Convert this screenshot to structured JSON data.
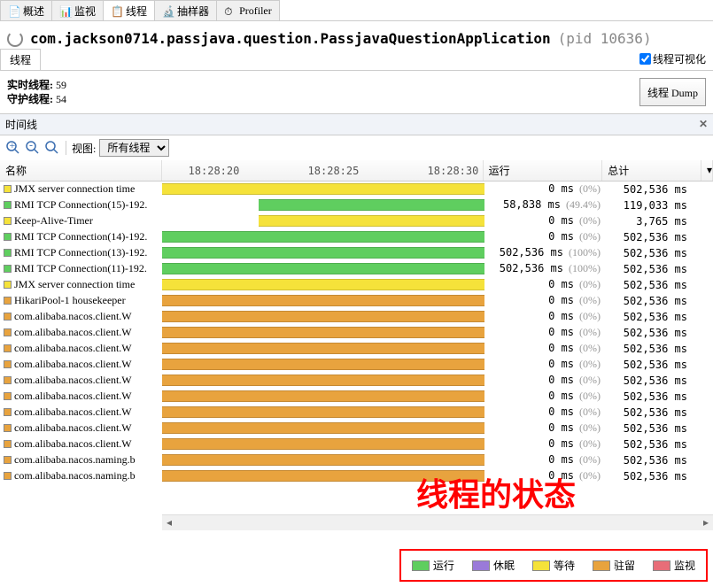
{
  "tabs": [
    "概述",
    "监视",
    "线程",
    "抽样器",
    "Profiler"
  ],
  "active_tab_index": 2,
  "app": "com.jackson0714.passjava.question.PassjavaQuestionApplication",
  "pid_label": "(pid 10636)",
  "sub_tab": "线程",
  "viz_checkbox": "线程可视化",
  "viz_checked": true,
  "stats": {
    "live_label": "实时线程:",
    "live": "59",
    "daemon_label": "守护线程:",
    "daemon": "54"
  },
  "dump_btn": "线程 Dump",
  "timeline_label": "时间线",
  "toolbar": {
    "zoom_in": "+",
    "zoom_out": "-",
    "zoom_fit": "↔",
    "view_label": "视图:",
    "view_value": "所有线程"
  },
  "cols": {
    "name": "名称",
    "run": "运行",
    "total": "总计"
  },
  "ticks": [
    "18:28:20",
    "18:28:25",
    "18:28:30"
  ],
  "colors": {
    "run": "#5fce5f",
    "sleep": "#9a7ad9",
    "wait": "#f5e23a",
    "park": "#e8a33e",
    "monitor": "#e86d78"
  },
  "rows": [
    {
      "name": "JMX server connection time",
      "state": "wait",
      "run": "0 ms",
      "pct": "(0%)",
      "tot": "502,536 ms"
    },
    {
      "name": "RMI TCP Connection(15)-192.",
      "state": "run",
      "run": "58,838 ms",
      "pct": "(49.4%)",
      "tot": "119,033 ms"
    },
    {
      "name": "Keep-Alive-Timer",
      "state": "wait",
      "run": "0 ms",
      "pct": "(0%)",
      "tot": "3,765 ms"
    },
    {
      "name": "RMI TCP Connection(14)-192.",
      "state": "run",
      "run": "0 ms",
      "pct": "(0%)",
      "tot": "502,536 ms"
    },
    {
      "name": "RMI TCP Connection(13)-192.",
      "state": "run",
      "run": "502,536 ms",
      "pct": "(100%)",
      "tot": "502,536 ms"
    },
    {
      "name": "RMI TCP Connection(11)-192.",
      "state": "run",
      "run": "502,536 ms",
      "pct": "(100%)",
      "tot": "502,536 ms"
    },
    {
      "name": "JMX server connection time",
      "state": "wait",
      "run": "0 ms",
      "pct": "(0%)",
      "tot": "502,536 ms"
    },
    {
      "name": "HikariPool-1 housekeeper",
      "state": "park",
      "run": "0 ms",
      "pct": "(0%)",
      "tot": "502,536 ms"
    },
    {
      "name": "com.alibaba.nacos.client.W",
      "state": "park",
      "run": "0 ms",
      "pct": "(0%)",
      "tot": "502,536 ms"
    },
    {
      "name": "com.alibaba.nacos.client.W",
      "state": "park",
      "run": "0 ms",
      "pct": "(0%)",
      "tot": "502,536 ms"
    },
    {
      "name": "com.alibaba.nacos.client.W",
      "state": "park",
      "run": "0 ms",
      "pct": "(0%)",
      "tot": "502,536 ms"
    },
    {
      "name": "com.alibaba.nacos.client.W",
      "state": "park",
      "run": "0 ms",
      "pct": "(0%)",
      "tot": "502,536 ms"
    },
    {
      "name": "com.alibaba.nacos.client.W",
      "state": "park",
      "run": "0 ms",
      "pct": "(0%)",
      "tot": "502,536 ms"
    },
    {
      "name": "com.alibaba.nacos.client.W",
      "state": "park",
      "run": "0 ms",
      "pct": "(0%)",
      "tot": "502,536 ms"
    },
    {
      "name": "com.alibaba.nacos.client.W",
      "state": "park",
      "run": "0 ms",
      "pct": "(0%)",
      "tot": "502,536 ms"
    },
    {
      "name": "com.alibaba.nacos.client.W",
      "state": "park",
      "run": "0 ms",
      "pct": "(0%)",
      "tot": "502,536 ms"
    },
    {
      "name": "com.alibaba.nacos.client.W",
      "state": "park",
      "run": "0 ms",
      "pct": "(0%)",
      "tot": "502,536 ms"
    },
    {
      "name": "com.alibaba.nacos.naming.b",
      "state": "park",
      "run": "0 ms",
      "pct": "(0%)",
      "tot": "502,536 ms"
    },
    {
      "name": "com.alibaba.nacos.naming.b",
      "state": "park",
      "run": "0 ms",
      "pct": "(0%)",
      "tot": "502,536 ms"
    }
  ],
  "annotation": "线程的状态",
  "legend": [
    {
      "label": "运行",
      "color": "#5fce5f"
    },
    {
      "label": "休眠",
      "color": "#9a7ad9"
    },
    {
      "label": "等待",
      "color": "#f5e23a"
    },
    {
      "label": "驻留",
      "color": "#e8a33e"
    },
    {
      "label": "监视",
      "color": "#e86d78"
    }
  ]
}
